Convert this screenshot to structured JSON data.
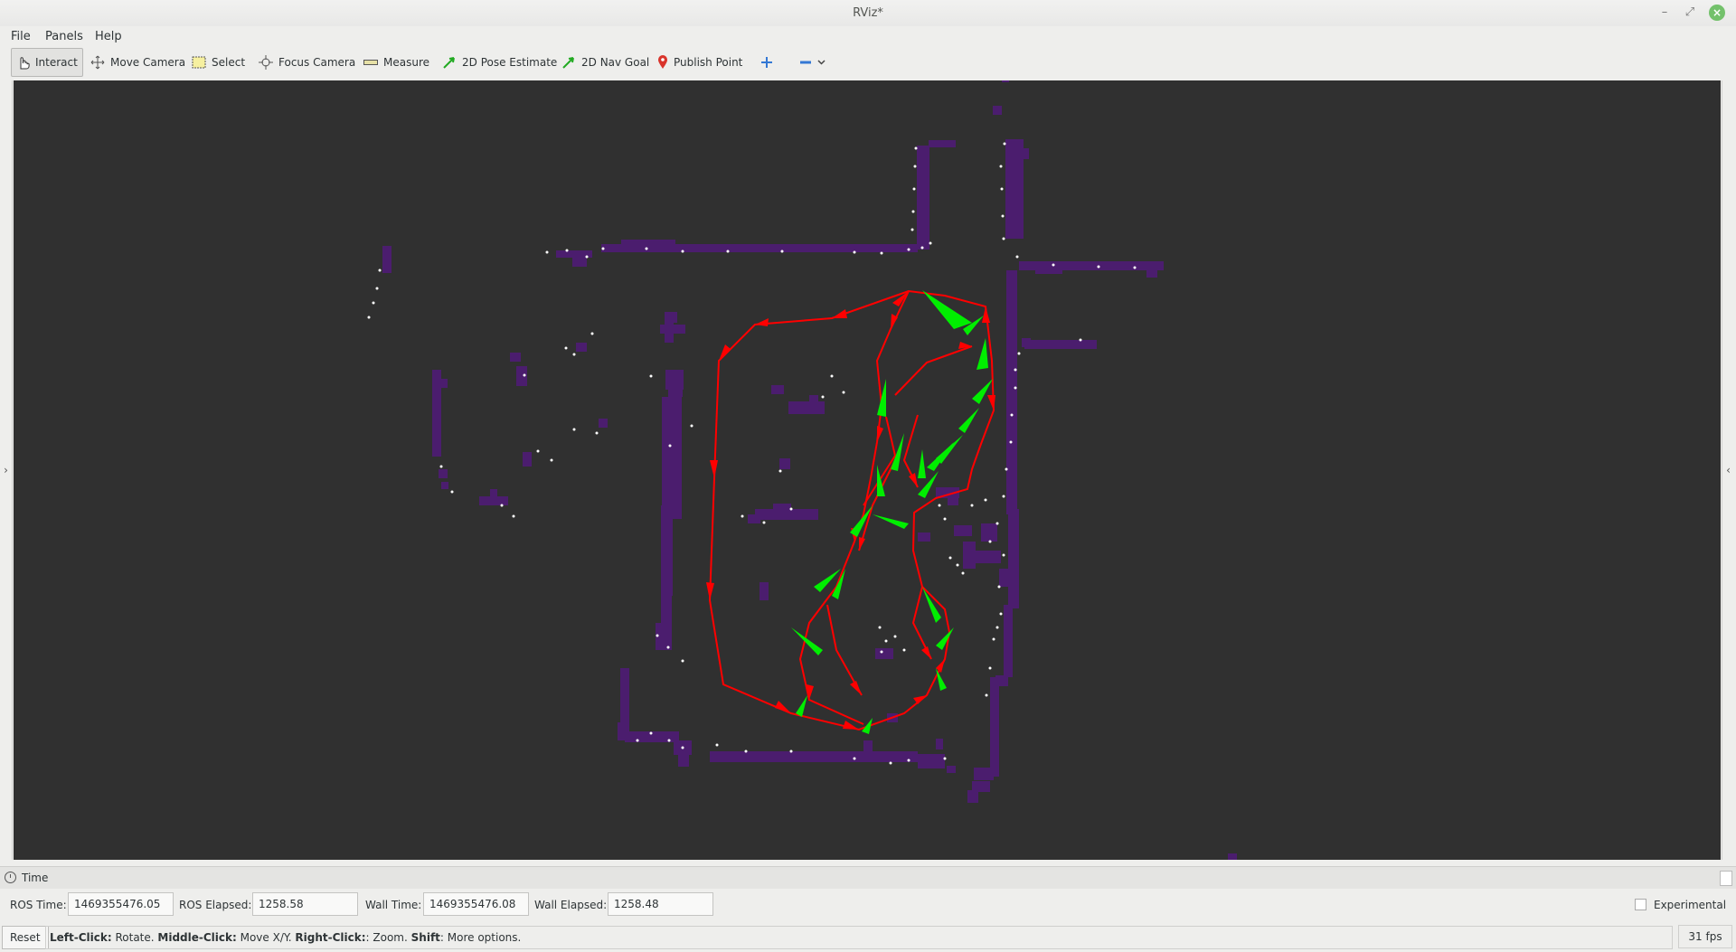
{
  "window": {
    "title": "RViz*"
  },
  "menu": {
    "items": [
      "File",
      "Panels",
      "Help"
    ]
  },
  "toolbar": {
    "tools": [
      {
        "label": "Interact",
        "icon": "hand-pointer-icon",
        "active": true
      },
      {
        "label": "Move Camera",
        "icon": "move-camera-icon"
      },
      {
        "label": "Select",
        "icon": "select-box-icon"
      },
      {
        "label": "Focus Camera",
        "icon": "focus-camera-icon"
      },
      {
        "label": "Measure",
        "icon": "measure-ruler-icon"
      },
      {
        "label": "2D Pose Estimate",
        "icon": "pose-arrow-icon"
      },
      {
        "label": "2D Nav Goal",
        "icon": "nav-goal-arrow-icon"
      },
      {
        "label": "Publish Point",
        "icon": "map-pin-icon"
      }
    ],
    "add_tool_icon": "plus-icon",
    "remove_tool_icon": "minus-icon",
    "menu_icon": "chevron-down-icon"
  },
  "side_toggles": {
    "left": "›",
    "right": "‹"
  },
  "time_panel": {
    "title": "Time",
    "ros_time_label": "ROS Time:",
    "ros_time": "1469355476.05",
    "ros_elapsed_label": "ROS Elapsed:",
    "ros_elapsed": "1258.58",
    "wall_time_label": "Wall Time:",
    "wall_time": "1469355476.08",
    "wall_elapsed_label": "Wall Elapsed:",
    "wall_elapsed": "1258.48",
    "experimental_label": "Experimental"
  },
  "status": {
    "reset_label": "Reset",
    "help": [
      {
        "b": "Left-Click:",
        "t": " Rotate. "
      },
      {
        "b": "Middle-Click:",
        "t": " Move X/Y. "
      },
      {
        "b": "Right-Click:",
        "t": ": Zoom. "
      },
      {
        "b": "Shift",
        "t": ": More options."
      }
    ],
    "fps": "31 fps"
  },
  "colors": {
    "viewport_bg": "#303030",
    "map_cells": "#4b1d6e",
    "laser_points": "#ffffff",
    "pose_arrows": "#ff0000",
    "particle_arrows": "#00ee00"
  }
}
